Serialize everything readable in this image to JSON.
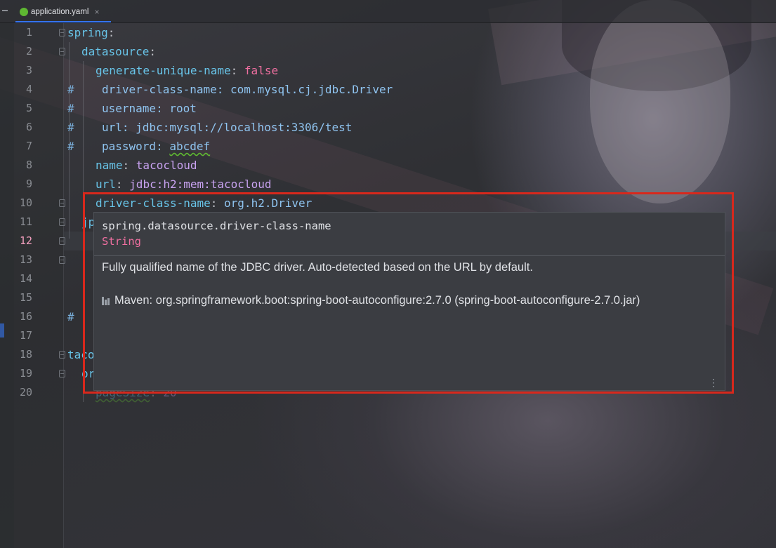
{
  "tab": {
    "label": "application.yaml",
    "close": "×"
  },
  "lines": {
    "1": "1",
    "2": "2",
    "3": "3",
    "4": "4",
    "5": "5",
    "6": "6",
    "7": "7",
    "8": "8",
    "9": "9",
    "10": "10",
    "11": "11",
    "12": "12",
    "13": "13",
    "14": "14",
    "15": "15",
    "16": "16",
    "17": "17",
    "18": "18",
    "19": "19",
    "20": "20"
  },
  "code": {
    "l1": {
      "key": "spring",
      "colon": ":"
    },
    "l2": {
      "key": "datasource",
      "colon": ":"
    },
    "l3": {
      "key": "generate-unique-name",
      "colon": ": ",
      "value": "false"
    },
    "l4": {
      "hash": "#",
      "text": "driver-class-name: com.mysql.cj.jdbc.Driver"
    },
    "l5": {
      "hash": "#",
      "text": "username: root"
    },
    "l6": {
      "hash": "#",
      "text": "url: jdbc:mysql://localhost:3306/test"
    },
    "l7": {
      "hash": "#",
      "key": "password: ",
      "value": "abcdef"
    },
    "l8": {
      "key": "name",
      "colon": ": ",
      "value": "tacocloud"
    },
    "l9": {
      "key": "url",
      "colon": ": ",
      "value": "jdbc:h2:mem:tacocloud"
    },
    "l10": {
      "key": "driver-class-name",
      "colon": ": ",
      "value": "org.h2.Driver"
    },
    "l11": {
      "key": "jp"
    },
    "l16": {
      "hash": "#"
    },
    "l18": {
      "key": "taco"
    },
    "l19": {
      "key": "or"
    },
    "l20": {
      "key": "pageSize",
      "colon": ": ",
      "value": "20"
    }
  },
  "popup": {
    "property": "spring.datasource.driver-class-name",
    "type": "String",
    "description": "Fully qualified name of the JDBC driver. Auto-detected based on the URL by default.",
    "source": "Maven: org.springframework.boot:spring-boot-autoconfigure:2.7.0 (spring-boot-autoconfigure-2.7.0.jar)",
    "more": "⋮"
  },
  "colors": {
    "accent": "#3574f0",
    "annotation_box": "#d8281c",
    "keyword": "#ef6fa0",
    "key": "#68c4e8"
  }
}
